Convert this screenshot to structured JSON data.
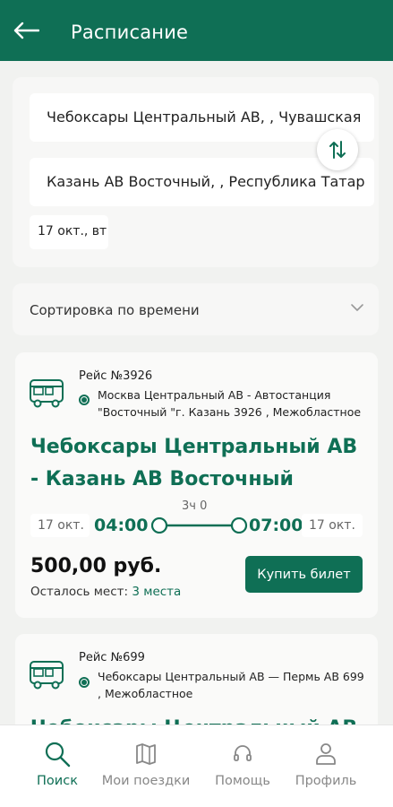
{
  "header": {
    "title": "Расписание"
  },
  "search": {
    "from": "Чебоксары Центральный АВ, , Чувашская",
    "to": "Казань АВ Восточный, , Республика Татар",
    "date": "17 окт., вт"
  },
  "sort": {
    "label": "Сортировка по времени"
  },
  "trips": [
    {
      "route_number": "Рейс №3926",
      "description": "Москва Центральный АВ - Автостанция \"Восточный \"г. Казань 3926 , Межобластное",
      "title": "Чебоксары Центральный АВ - Казань АВ Восточный",
      "departure_date": "17 окт.",
      "departure_time": "04:00",
      "duration": "3ч 0",
      "arrival_time": "07:00",
      "arrival_date": "17 окт.",
      "price": "500,00 руб.",
      "seats_label": "Осталось мест:",
      "seats_value": "3 места",
      "buy_label": "Купить билет"
    },
    {
      "route_number": "Рейс №699",
      "description": "Чебоксары Центральный АВ — Пермь АВ 699 , Межобластное",
      "title": "Чебоксары Центральный АВ -"
    }
  ],
  "tabs": [
    {
      "label": "Поиск",
      "icon": "search-icon",
      "active": true
    },
    {
      "label": "Мои поездки",
      "icon": "map-icon",
      "active": false
    },
    {
      "label": "Помощь",
      "icon": "headset-icon",
      "active": false
    },
    {
      "label": "Профиль",
      "icon": "user-icon",
      "active": false
    }
  ],
  "colors": {
    "primary": "#0f6f55",
    "background": "#f1f2f0",
    "card": "#fafaf9"
  }
}
